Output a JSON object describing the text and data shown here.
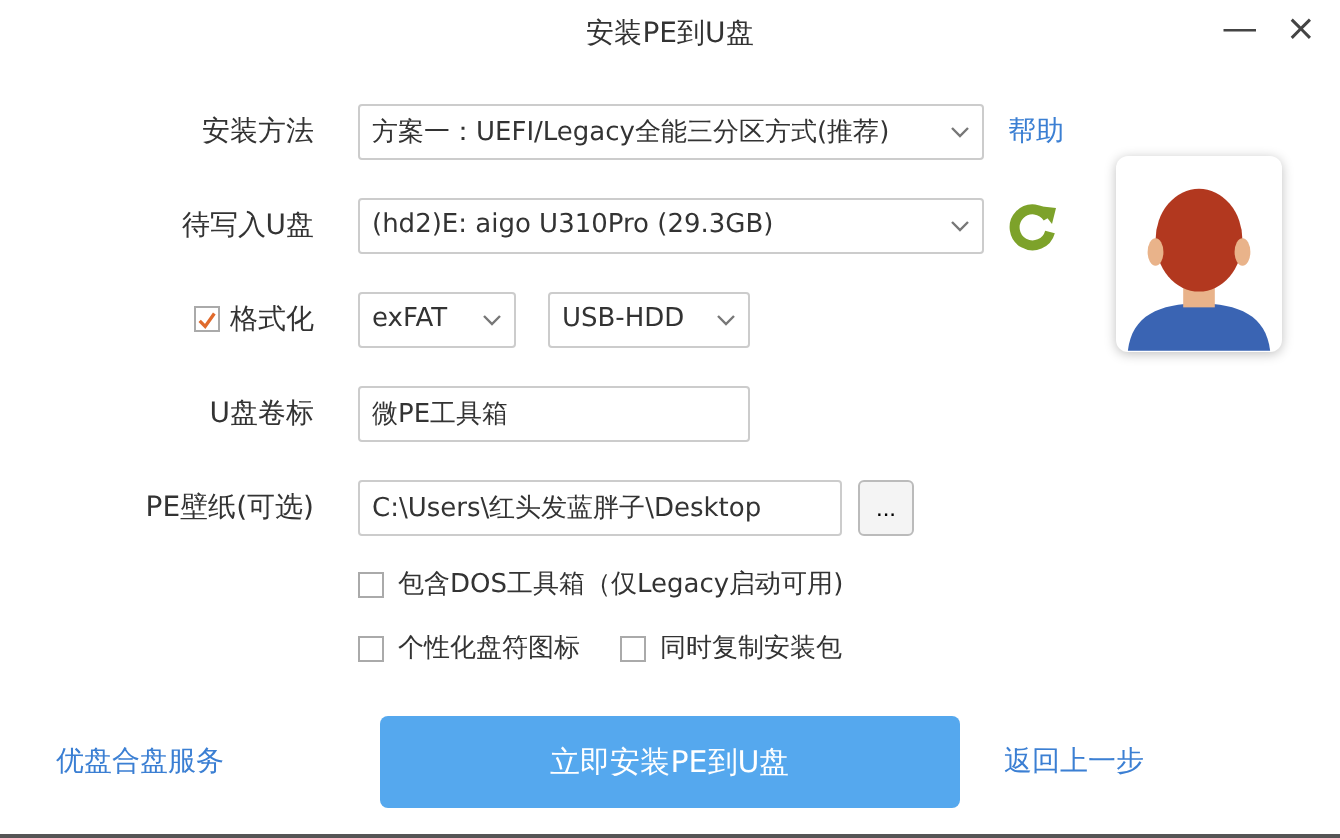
{
  "window": {
    "title": "安装PE到U盘",
    "minimize": "—",
    "close": "×"
  },
  "fields": [
    {
      "kind": "select",
      "label": "安装方法",
      "value": "方案一：UEFI/Legacy全能三分区方式(推荐)",
      "link": "帮助"
    },
    {
      "kind": "select-refresh",
      "label": "待写入U盘",
      "value": "(hd2)E: aigo U310Pro (29.3GB)"
    },
    {
      "kind": "format",
      "label": "格式化",
      "checked": true,
      "selects": [
        "exFAT",
        "USB-HDD"
      ]
    },
    {
      "kind": "text",
      "label": "U盘卷标",
      "value": "微PE工具箱"
    },
    {
      "kind": "browse",
      "label": "PE壁纸(可选)",
      "value": "C:\\Users\\红头发蓝胖子\\Desktop",
      "button": "..."
    }
  ],
  "options": [
    [
      {
        "label": "包含DOS工具箱（仅Legacy启动可用)",
        "checked": false
      }
    ],
    [
      {
        "label": "个性化盘符图标",
        "checked": false
      },
      {
        "label": "同时复制安装包",
        "checked": false
      }
    ]
  ],
  "footer": {
    "left_link": "优盘合盘服务",
    "primary_button": "立即安装PE到U盘",
    "right_link": "返回上一步"
  }
}
